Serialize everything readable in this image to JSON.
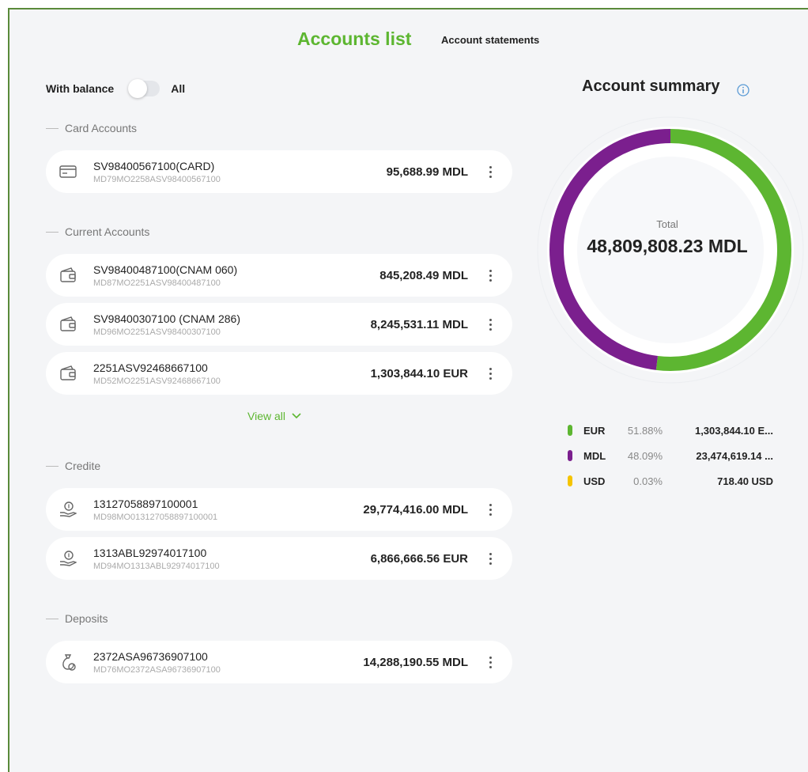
{
  "tabs": {
    "active": "Accounts list",
    "statements": "Account statements"
  },
  "filter": {
    "with_balance": "With balance",
    "all": "All"
  },
  "sections": {
    "card": {
      "title": "Card Accounts",
      "items": [
        {
          "name": "SV98400567100(CARD)",
          "sub": "MD79MO2258ASV98400567100",
          "amount": "95,688.99 MDL",
          "icon": "card-icon"
        }
      ]
    },
    "current": {
      "title": "Current Accounts",
      "items": [
        {
          "name": "SV98400487100(CNAM 060)",
          "sub": "MD87MO2251ASV98400487100",
          "amount": "845,208.49 MDL",
          "icon": "wallet-icon"
        },
        {
          "name": "SV98400307100 (CNAM 286)",
          "sub": "MD96MO2251ASV98400307100",
          "amount": "8,245,531.11 MDL",
          "icon": "wallet-icon"
        },
        {
          "name": "2251ASV92468667100",
          "sub": "MD52MO2251ASV92468667100",
          "amount": "1,303,844.10 EUR",
          "icon": "wallet-icon"
        }
      ],
      "view_all": "View all"
    },
    "credits": {
      "title": "Credite",
      "items": [
        {
          "name": "13127058897100001",
          "sub": "MD98MO013127058897100001",
          "amount": "29,774,416.00 MDL",
          "icon": "hand-coin-icon"
        },
        {
          "name": "1313ABL92974017100",
          "sub": "MD94MO1313ABL92974017100",
          "amount": "6,866,666.56 EUR",
          "icon": "hand-coin-icon"
        }
      ]
    },
    "deposits": {
      "title": "Deposits",
      "items": [
        {
          "name": "2372ASA96736907100",
          "sub": "MD76MO2372ASA96736907100",
          "amount": "14,288,190.55 MDL",
          "icon": "money-bag-icon"
        }
      ]
    }
  },
  "summary": {
    "title": "Account summary",
    "total_label": "Total",
    "total_value": "48,809,808.23 MDL",
    "legend": [
      {
        "currency": "EUR",
        "pct": "51.88%",
        "value": "1,303,844.10 E...",
        "color": "#5db631",
        "fraction": 0.5188
      },
      {
        "currency": "MDL",
        "pct": "48.09%",
        "value": "23,474,619.14 ...",
        "color": "#7b1f8e",
        "fraction": 0.4809
      },
      {
        "currency": "USD",
        "pct": "0.03%",
        "value": "718.40 USD",
        "color": "#f5c400",
        "fraction": 0.0003
      }
    ]
  },
  "colors": {
    "accent": "#5db631",
    "purple": "#7b1f8e",
    "yellow": "#f5c400"
  }
}
